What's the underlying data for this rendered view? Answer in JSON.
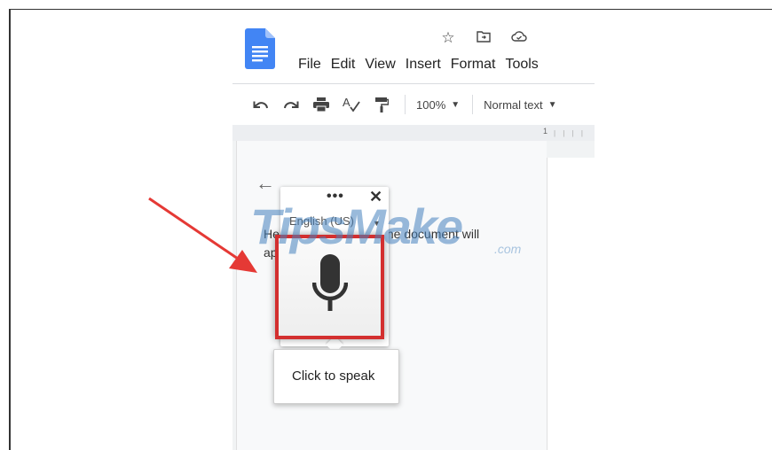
{
  "menu": {
    "items": [
      "File",
      "Edit",
      "View",
      "Insert",
      "Format",
      "Tools"
    ]
  },
  "title_icons": [
    "star-icon",
    "move-to-folder-icon",
    "cloud-status-icon"
  ],
  "toolbar": {
    "icons": [
      "undo-icon",
      "redo-icon",
      "print-icon",
      "spellcheck-icon",
      "paint-format-icon"
    ],
    "zoom": "100%",
    "style": "Normal text"
  },
  "ruler": {
    "number": "1"
  },
  "document": {
    "text_line1_start": "He",
    "text_line1_end": "the document will",
    "text_line2_start": "ap"
  },
  "voice_typing": {
    "more_label": "•••",
    "close_label": "✕",
    "language": "English (US)",
    "tooltip": "Click to speak"
  },
  "watermark": {
    "main": "TipsMake",
    "suffix": ".com"
  },
  "colors": {
    "highlight": "#d32f2f",
    "docs_blue": "#4285f4"
  }
}
